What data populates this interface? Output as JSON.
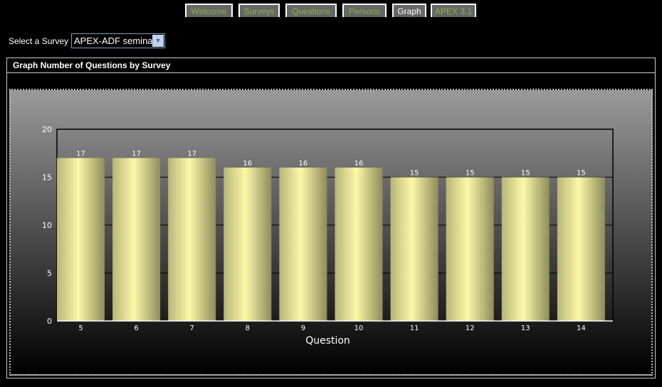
{
  "tabs": [
    {
      "label": "Welcome"
    },
    {
      "label": "Surveys"
    },
    {
      "label": "Questions"
    },
    {
      "label": "Persons"
    },
    {
      "label": "Graph"
    },
    {
      "label": "APEX 3.1"
    }
  ],
  "survey": {
    "label": "Select a Survey",
    "value": "APEX-ADF seminar"
  },
  "region": {
    "title": "Graph Number of Questions by Survey"
  },
  "chart_data": {
    "type": "bar",
    "title": "",
    "xlabel": "Question",
    "ylabel": "",
    "categories": [
      "5",
      "6",
      "7",
      "8",
      "9",
      "10",
      "11",
      "12",
      "13",
      "14"
    ],
    "values": [
      17,
      17,
      17,
      16,
      16,
      16,
      15,
      15,
      15,
      15
    ],
    "ylim": [
      0,
      20
    ],
    "yticks": [
      0,
      5,
      10,
      15,
      20
    ],
    "grid": true,
    "bar_color": "#f8f5a6"
  }
}
